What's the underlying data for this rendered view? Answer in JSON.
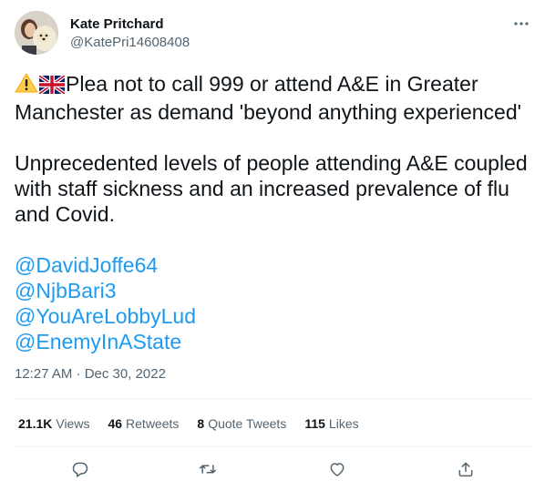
{
  "author": {
    "name": "Kate Pritchard",
    "handle": "@KatePri14608408"
  },
  "tweet": {
    "headline": "Plea not to call 999 or attend A&E in Greater Manchester as demand 'beyond anything experienced'",
    "paragraph": "Unprecedented levels of people attending A&E coupled with staff sickness and an increased prevalence of flu and Covid.",
    "mentions": [
      "@DavidJoffe64",
      "@NjbBari3",
      "@YouAreLobbyLud",
      "@EnemyInAState"
    ],
    "timestamp": "12:27 AM · Dec 30, 2022"
  },
  "stats": {
    "views_count": "21.1K",
    "views_label": "Views",
    "retweets_count": "46",
    "retweets_label": "Retweets",
    "quotes_count": "8",
    "quotes_label": "Quote Tweets",
    "likes_count": "115",
    "likes_label": "Likes"
  },
  "icons": {
    "more": "more-icon",
    "reply": "reply-icon",
    "retweet": "retweet-icon",
    "like": "like-icon",
    "share": "share-icon",
    "warning": "warning-icon",
    "flag": "uk-flag-icon"
  },
  "colors": {
    "text": "#0f1419",
    "secondary": "#536471",
    "link": "#1d9bf0",
    "divider": "#eff3f4"
  }
}
